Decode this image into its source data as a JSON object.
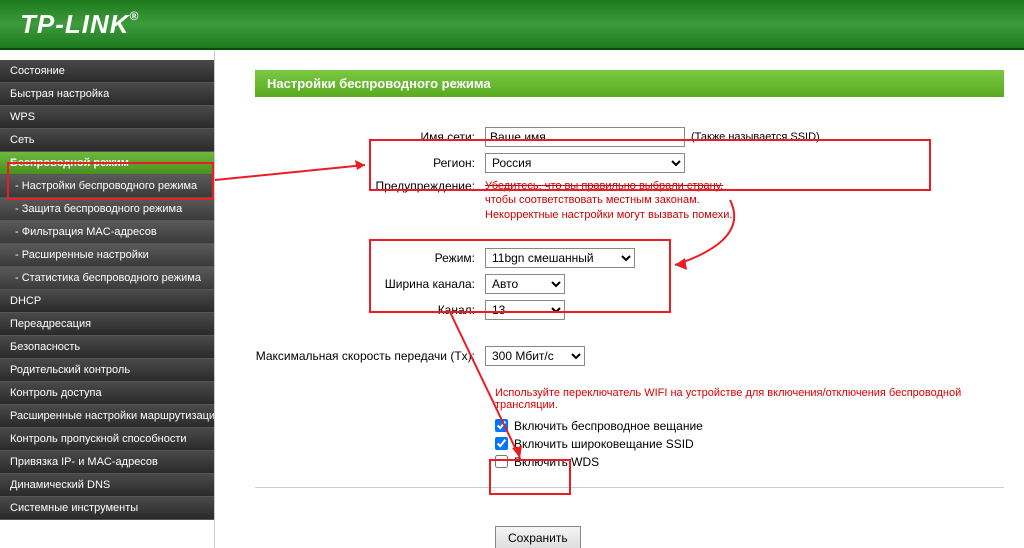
{
  "brand": "TP-LINK",
  "sidebar": {
    "items": [
      {
        "label": "Состояние",
        "type": "item"
      },
      {
        "label": "Быстрая настройка",
        "type": "item"
      },
      {
        "label": "WPS",
        "type": "item"
      },
      {
        "label": "Сеть",
        "type": "item"
      },
      {
        "label": "Беспроводной режим",
        "type": "active"
      },
      {
        "label": "- Настройки беспроводного режима",
        "type": "sub selected"
      },
      {
        "label": "- Защита беспроводного режима",
        "type": "sub"
      },
      {
        "label": "- Фильтрация MAC-адресов",
        "type": "sub"
      },
      {
        "label": "- Расширенные настройки",
        "type": "sub"
      },
      {
        "label": "- Статистика беспроводного режима",
        "type": "sub"
      },
      {
        "label": "DHCP",
        "type": "item"
      },
      {
        "label": "Переадресация",
        "type": "item"
      },
      {
        "label": "Безопасность",
        "type": "item"
      },
      {
        "label": "Родительский контроль",
        "type": "item"
      },
      {
        "label": "Контроль доступа",
        "type": "item"
      },
      {
        "label": "Расширенные настройки маршрутизации",
        "type": "item"
      },
      {
        "label": "Контроль пропускной способности",
        "type": "item"
      },
      {
        "label": "Привязка IP- и MAC-адресов",
        "type": "item"
      },
      {
        "label": "Динамический DNS",
        "type": "item"
      },
      {
        "label": "Системные инструменты",
        "type": "item"
      }
    ]
  },
  "main": {
    "title": "Настройки беспроводного режима",
    "ssid_label": "Имя сети:",
    "ssid_value": "Ваше имя",
    "ssid_note": "(Также называется SSID)",
    "region_label": "Регион:",
    "region_value": "Россия",
    "warning_label": "Предупреждение:",
    "warning_text1": "Убедитесь, что вы правильно выбрали страну,",
    "warning_text2": "чтобы соответствовать местным законам.",
    "warning_text3": "Некорректные настройки могут вызвать помехи.",
    "mode_label": "Режим:",
    "mode_value": "11bgn смешанный",
    "width_label": "Ширина канала:",
    "width_value": "Авто",
    "channel_label": "Канал:",
    "channel_value": "13",
    "maxrate_label": "Максимальная скорость передачи (Tx):",
    "maxrate_value": "300 Мбит/с",
    "hint": "Используйте переключатель WIFI на устройстве для включения/отключения беспроводной трансляции.",
    "cb1": "Включить беспроводное вещание",
    "cb2": "Включить широковещание SSID",
    "cb3": "Включить WDS",
    "save": "Сохранить"
  }
}
